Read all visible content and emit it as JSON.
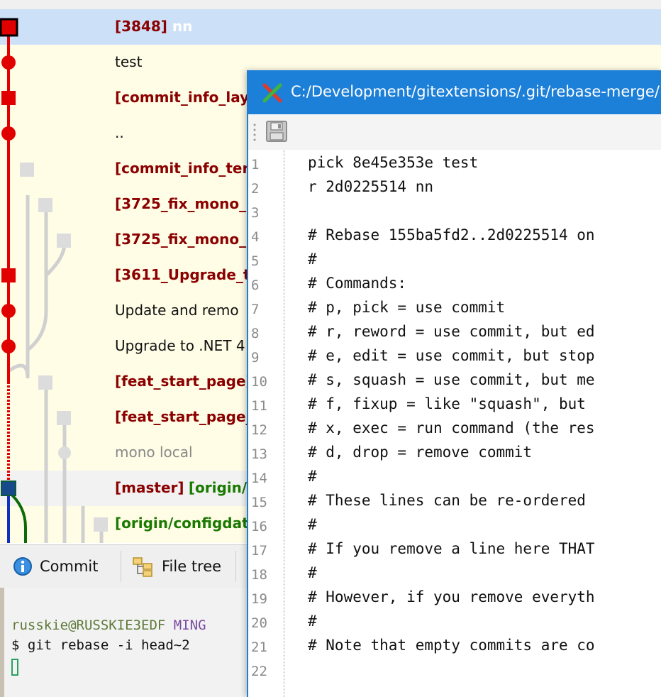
{
  "revision_grid": {
    "rows": [
      {
        "parts": [
          {
            "text": "[3848]",
            "style": "branch"
          },
          {
            "text": " nn",
            "style": "whitebold"
          }
        ]
      },
      {
        "parts": [
          {
            "text": "test",
            "style": ""
          }
        ]
      },
      {
        "parts": [
          {
            "text": "[commit_info_lay",
            "style": "branch"
          }
        ]
      },
      {
        "parts": [
          {
            "text": "..",
            "style": ""
          }
        ]
      },
      {
        "parts": [
          {
            "text": "[commit_info_ter",
            "style": "branch"
          }
        ]
      },
      {
        "parts": [
          {
            "text": "[3725_fix_mono_",
            "style": "branch"
          }
        ]
      },
      {
        "parts": [
          {
            "text": "[3725_fix_mono_",
            "style": "branch"
          }
        ]
      },
      {
        "parts": [
          {
            "text": "[3611_Upgrade_t",
            "style": "branch"
          }
        ]
      },
      {
        "parts": [
          {
            "text": "Update and remo",
            "style": ""
          }
        ]
      },
      {
        "parts": [
          {
            "text": "Upgrade to .NET 4",
            "style": ""
          }
        ]
      },
      {
        "parts": [
          {
            "text": "[feat_start_page]",
            "style": "branch"
          }
        ]
      },
      {
        "parts": [
          {
            "text": "[feat_start_page_",
            "style": "branch"
          }
        ]
      },
      {
        "parts": [
          {
            "text": "mono local",
            "style": "dim"
          }
        ]
      },
      {
        "parts": [
          {
            "text": "[master]",
            "style": "branch"
          },
          {
            "text": " ",
            "style": ""
          },
          {
            "text": "[origin/",
            "style": "remote"
          }
        ]
      },
      {
        "parts": [
          {
            "text": "[origin/configdat",
            "style": "remote"
          }
        ]
      }
    ]
  },
  "tabs": [
    {
      "label": "Commit",
      "icon": "info-icon"
    },
    {
      "label": "File tree",
      "icon": "file-tree-icon"
    }
  ],
  "terminal": {
    "prompt_user": "russkie@RUSSKIE3EDF",
    "prompt_env": " MING",
    "command": "$ git rebase -i head~2"
  },
  "editor": {
    "title": "C:/Development/gitextensions/.git/rebase-merge/",
    "lines": [
      "pick 8e45e353e test",
      "r 2d0225514 nn",
      "",
      "# Rebase 155ba5fd2..2d0225514 on",
      "#",
      "# Commands:",
      "# p, pick = use commit",
      "# r, reword = use commit, but ed",
      "# e, edit = use commit, but stop",
      "# s, squash = use commit, but me",
      "# f, fixup = like \"squash\", but",
      "# x, exec = run command (the res",
      "# d, drop = remove commit",
      "#",
      "# These lines can be re-ordered",
      "#",
      "# If you remove a line here THAT",
      "#",
      "# However, if you remove everyth",
      "#",
      "# Note that empty commits are co",
      ""
    ],
    "line_numbers": [
      "1",
      "2",
      "3",
      "4",
      "5",
      "6",
      "7",
      "8",
      "9",
      "10",
      "11",
      "12",
      "13",
      "14",
      "15",
      "16",
      "17",
      "18",
      "19",
      "20",
      "21",
      "22"
    ]
  },
  "colors": {
    "graph_red": "#e00000",
    "graph_grey": "#d0d0d0",
    "graph_green": "#0b6b0b",
    "graph_blue": "#1030c0",
    "titlebar_blue": "#1c7fd8"
  }
}
